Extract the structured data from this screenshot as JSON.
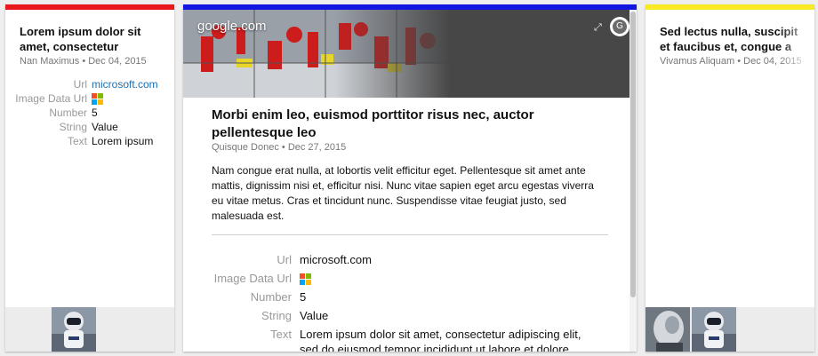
{
  "cards": {
    "left": {
      "accent_color": "#e8171b",
      "title_line1": "Lorem ipsum dolor sit",
      "title_line2": "amet, consectetur",
      "author": "Nan Maximus",
      "separator": "•",
      "date": "Dec 04, 2015",
      "fields": [
        {
          "label": "Url",
          "value": "microsoft.com"
        },
        {
          "label": "Image Data Url",
          "value": ""
        },
        {
          "label": "Number",
          "value": "5"
        },
        {
          "label": "String",
          "value": "Value"
        },
        {
          "label": "Text",
          "value": "Lorem ipsum"
        }
      ]
    },
    "center": {
      "accent_color": "#1316e0",
      "domain": "google.com",
      "badge_letter": "G",
      "expand_icon": "expand-icon",
      "title": "Morbi enim leo, euismod porttitor risus nec, auctor pellentesque leo",
      "author": "Quisque Donec",
      "separator": "•",
      "date": "Dec 27, 2015",
      "description": "Nam congue erat nulla, at lobortis velit efficitur eget. Pellentesque sit amet ante mattis, dignissim nisi et, efficitur nisi. Nunc vitae sapien eget arcu egestas viverra eu vitae metus. Cras et tincidunt nunc. Suspendisse vitae feugiat justo, sed malesuada est.",
      "fields": [
        {
          "label": "Url",
          "value": "microsoft.com"
        },
        {
          "label": "Image Data Url",
          "value": ""
        },
        {
          "label": "Number",
          "value": "5"
        },
        {
          "label": "String",
          "value": "Value"
        },
        {
          "label": "Text",
          "value": "Lorem ipsum dolor sit amet, consectetur adipiscing elit, sed do eiusmod tempor incididunt ut labore et dolore"
        }
      ]
    },
    "right": {
      "accent_color": "#f7ea24",
      "title_line1": "Sed lectus nulla, suscipit",
      "title_line2": "et faucibus et, congue a",
      "author": "Vivamus Aliquam",
      "separator": "•",
      "date": "Dec 04, 2015"
    }
  },
  "icons": {
    "ms_logo_colors": [
      "#f25022",
      "#7fba00",
      "#00a4ef",
      "#ffb900"
    ]
  }
}
